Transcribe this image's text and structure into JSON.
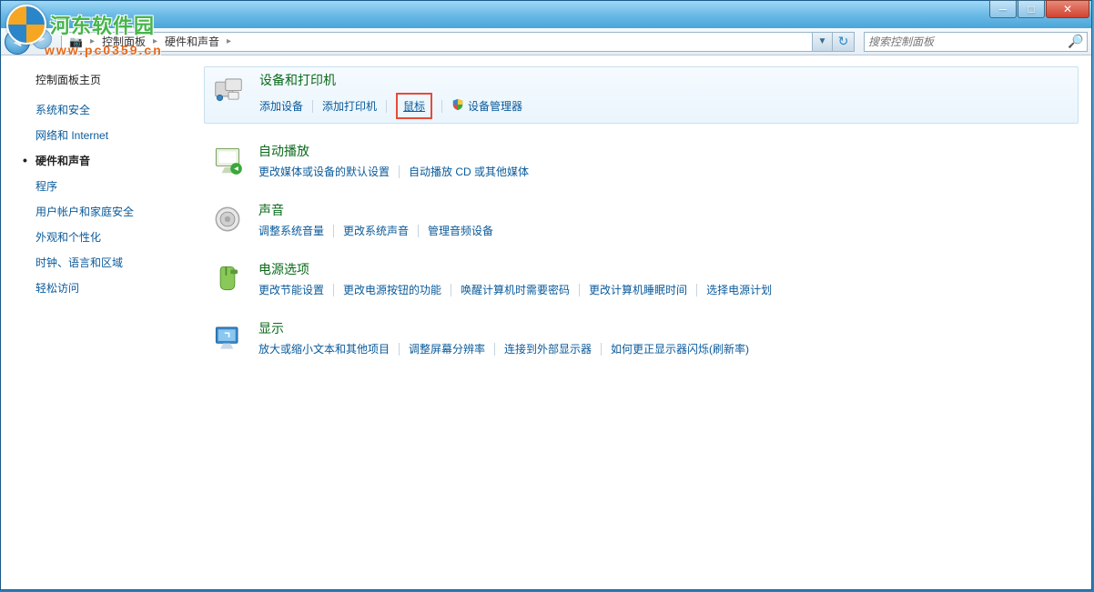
{
  "watermark": {
    "title": "河东软件园",
    "subtitle": "www.pc0359.cn"
  },
  "breadcrumb": {
    "parts": [
      "控制面板",
      "硬件和声音"
    ]
  },
  "search": {
    "placeholder": "搜索控制面板"
  },
  "sidebar": {
    "title": "控制面板主页",
    "items": [
      {
        "label": "系统和安全",
        "active": false
      },
      {
        "label": "网络和 Internet",
        "active": false
      },
      {
        "label": "硬件和声音",
        "active": true
      },
      {
        "label": "程序",
        "active": false
      },
      {
        "label": "用户帐户和家庭安全",
        "active": false
      },
      {
        "label": "外观和个性化",
        "active": false
      },
      {
        "label": "时钟、语言和区域",
        "active": false
      },
      {
        "label": "轻松访问",
        "active": false
      }
    ]
  },
  "categories": [
    {
      "title": "设备和打印机",
      "highlight": true,
      "links": [
        {
          "label": "添加设备"
        },
        {
          "label": "添加打印机"
        },
        {
          "label": "鼠标",
          "boxed": true
        },
        {
          "label": "设备管理器",
          "shield": true
        }
      ]
    },
    {
      "title": "自动播放",
      "links": [
        {
          "label": "更改媒体或设备的默认设置"
        },
        {
          "label": "自动播放 CD 或其他媒体"
        }
      ]
    },
    {
      "title": "声音",
      "links": [
        {
          "label": "调整系统音量"
        },
        {
          "label": "更改系统声音"
        },
        {
          "label": "管理音频设备"
        }
      ]
    },
    {
      "title": "电源选项",
      "links": [
        {
          "label": "更改节能设置"
        },
        {
          "label": "更改电源按钮的功能"
        },
        {
          "label": "唤醒计算机时需要密码"
        },
        {
          "label": "更改计算机睡眠时间"
        },
        {
          "label": "选择电源计划"
        }
      ]
    },
    {
      "title": "显示",
      "links": [
        {
          "label": "放大或缩小文本和其他项目"
        },
        {
          "label": "调整屏幕分辨率"
        },
        {
          "label": "连接到外部显示器"
        },
        {
          "label": "如何更正显示器闪烁(刷新率)"
        }
      ]
    }
  ]
}
